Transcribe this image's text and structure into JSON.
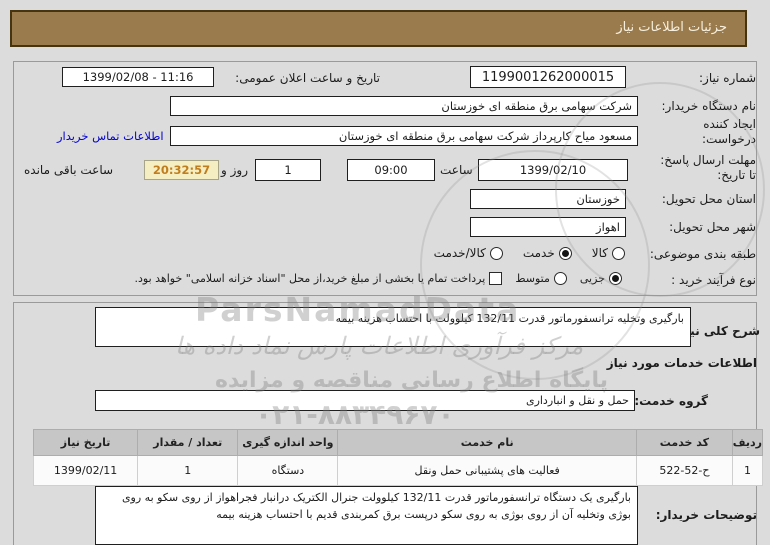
{
  "title_bar": {
    "text": "جزئیات اطلاعات نیاز"
  },
  "form": {
    "need_number": {
      "label": "شماره نیاز:",
      "value": "1199001262000015"
    },
    "announce": {
      "label": "تاریخ و ساعت اعلان عمومی:",
      "value": "1399/02/08 - 11:16"
    },
    "buyer_org": {
      "label": "نام دستگاه خریدار:",
      "value": "شرکت سهامی برق منطقه ای خوزستان"
    },
    "creator": {
      "label": "ایجاد کننده درخواست:",
      "value": "مسعود میاح کارپرداز شرکت سهامی برق منطقه ای خوزستان",
      "contact_link": "اطلاعات تماس خریدار"
    },
    "deadline": {
      "label_line1": "مهلت ارسال پاسخ:",
      "label_line2": "تا تاریخ:",
      "date": "1399/02/10",
      "hour_label": "ساعت",
      "time": "09:00",
      "days_value": "1",
      "days_label": "روز و",
      "countdown": "20:32:57",
      "remaining_label": "ساعت باقی مانده"
    },
    "province": {
      "label": "استان محل تحویل:",
      "value": "خوزستان"
    },
    "city": {
      "label": "شهر محل تحویل:",
      "value": "اهواز"
    },
    "category": {
      "label": "طبقه بندی موضوعی:",
      "options": [
        {
          "label": "کالا",
          "checked": false
        },
        {
          "label": "خدمت",
          "checked": true
        },
        {
          "label": "کالا/خدمت",
          "checked": false
        }
      ]
    },
    "purchase_type": {
      "label": "نوع فرآیند خرید :",
      "options": [
        {
          "label": "جزیی",
          "checked": true
        },
        {
          "label": "متوسط",
          "checked": false
        }
      ],
      "checkbox_checked": false,
      "checkbox_label": "پرداخت تمام یا بخشی از مبلغ خرید،از محل \"اسناد خزانه اسلامی\" خواهد بود."
    }
  },
  "description": {
    "label": "شرح کلی نیاز:",
    "value": "بارگیری وتخلیه ترانسفورماتور قدرت 132/11 کیلوولت با احتساب هزینه بیمه"
  },
  "services_section": {
    "header": "اطلاعات خدمات مورد نیاز",
    "service_group": {
      "label": "گروه خدمت:",
      "value": "حمل و نقل و انبارداری"
    },
    "table": {
      "headers": [
        "ردیف",
        "کد خدمت",
        "نام خدمت",
        "واحد اندازه گیری",
        "تعداد / مقدار",
        "تاریخ نیاز"
      ],
      "rows": [
        [
          "1",
          "ح-52-522",
          "فعالیت های پشتیبانی حمل ونقل",
          "دستگاه",
          "1",
          "1399/02/11"
        ]
      ]
    }
  },
  "buyer_notes": {
    "label": "توضیحات خریدار:",
    "value": "بارگیری یک دستگاه ترانسفورماتور قدرت 132/11 کیلوولت جنرال الکتریک درانبار فجراهواز از روی سکو به روی بوژی وتخلیه آن از روی بوژی به روی سکو درپست برق کمربندی قدیم با احتساب هزینه بیمه"
  },
  "watermark": {
    "latin": "ParsNamadData",
    "line1": "مرکز فرآوری اطلاعات پارس نماد داده ها",
    "line2": "پایگاه اطلاع رسانی مناقصه و مزایده",
    "phone": "۰۲۱-۸۸۳۴۹۶۷۰"
  },
  "colors": {
    "title_bg": "#9a7b4e",
    "title_border": "#46340f",
    "timer_bg": "#f4eec2",
    "timer_text": "#c07d1f",
    "link": "#0404cf",
    "table_header_bg": "#c6c6c6",
    "page_bg": "#dcdcdc"
  }
}
